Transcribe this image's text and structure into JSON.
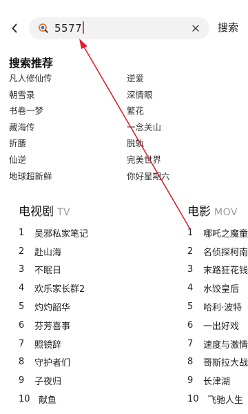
{
  "search": {
    "value": "5577",
    "button_label": "搜索"
  },
  "recommend": {
    "title": "搜索推荐",
    "items": [
      "凡人修仙传",
      "逆爱",
      "朝雪录",
      "深情眼",
      "书卷一梦",
      "繁花",
      "藏海传",
      "一念关山",
      "折腰",
      "脱轨",
      "仙逆",
      "完美世界",
      "地球超新鲜",
      "你好星期六"
    ]
  },
  "rankings": {
    "tv": {
      "title": "电视剧",
      "subtitle": "TV",
      "items": [
        {
          "rank": "1",
          "name": "吴邪私家笔记"
        },
        {
          "rank": "2",
          "name": "赴山海"
        },
        {
          "rank": "3",
          "name": "不眠日"
        },
        {
          "rank": "4",
          "name": "欢乐家长群2"
        },
        {
          "rank": "5",
          "name": "灼灼韶华"
        },
        {
          "rank": "6",
          "name": "芬芳喜事"
        },
        {
          "rank": "7",
          "name": "照镜辞"
        },
        {
          "rank": "8",
          "name": "守护者们"
        },
        {
          "rank": "9",
          "name": "子夜归"
        },
        {
          "rank": "10",
          "name": "献鱼"
        }
      ]
    },
    "movie": {
      "title": "电影",
      "subtitle": "MOV",
      "items": [
        {
          "rank": "1",
          "name": "哪吒之魔童"
        },
        {
          "rank": "2",
          "name": "名侦探柯南"
        },
        {
          "rank": "3",
          "name": "末路狂花钱"
        },
        {
          "rank": "4",
          "name": "水饺皇后"
        },
        {
          "rank": "5",
          "name": "哈利·波特"
        },
        {
          "rank": "6",
          "name": "一出好戏"
        },
        {
          "rank": "7",
          "name": "速度与激情"
        },
        {
          "rank": "8",
          "name": "哥斯拉大战"
        },
        {
          "rank": "9",
          "name": "长津湖"
        },
        {
          "rank": "10",
          "name": "飞驰人生"
        }
      ]
    }
  },
  "colors": {
    "accent": "#e04a32",
    "arrow": "#e0202a",
    "search_bg": "#f2f2f2"
  },
  "icons": {
    "back": "chevron-left-icon",
    "search": "search-icon",
    "clear": "close-icon"
  }
}
